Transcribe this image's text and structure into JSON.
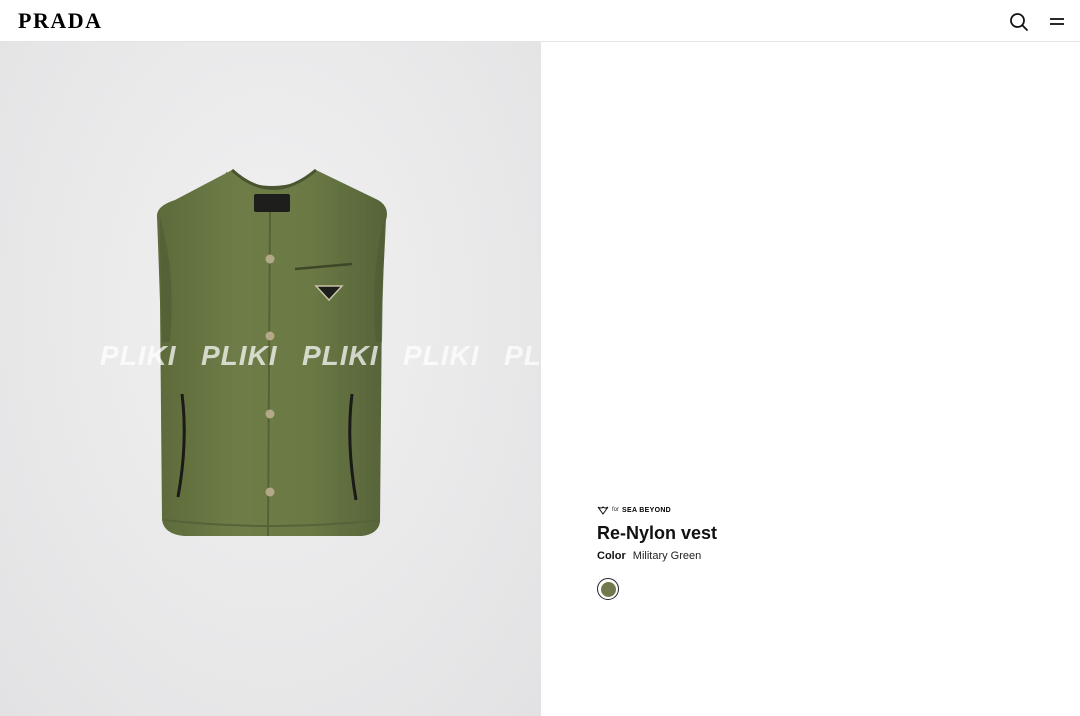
{
  "header": {
    "logo": "PRADA",
    "search_icon": "search-icon",
    "menu_icon": "menu-icon"
  },
  "gallery": {
    "watermark": [
      "PLIKI",
      "PLIKI",
      "PLIKI",
      "PLIKI",
      "PLIKI"
    ],
    "product_color": "#6b7a45",
    "background_color": "#e9e9ea"
  },
  "product": {
    "collection_for": "for",
    "collection_name": "SEA BEYOND",
    "name": "Re-Nylon vest",
    "color_label": "Color",
    "color_value": "Military Green",
    "swatch_color": "#707a4d"
  }
}
